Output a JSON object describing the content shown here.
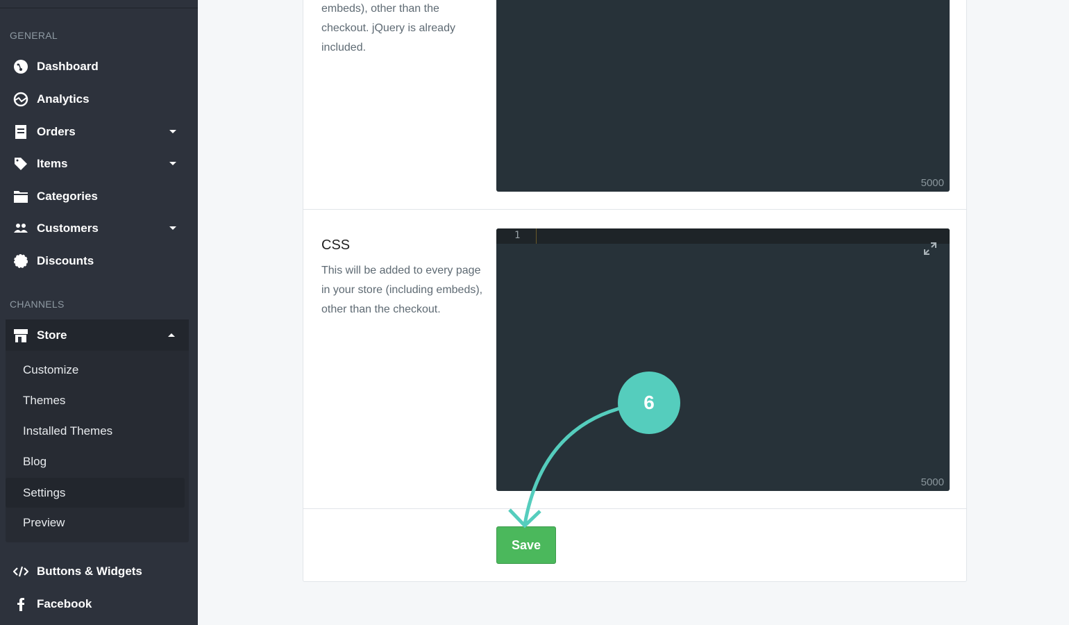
{
  "sidebar": {
    "general": "GENERAL",
    "items": [
      {
        "label": "Dashboard",
        "icon": "dashboard-icon"
      },
      {
        "label": "Analytics",
        "icon": "analytics-icon"
      },
      {
        "label": "Orders",
        "icon": "receipt-icon"
      },
      {
        "label": "Items",
        "icon": "tag-icon"
      },
      {
        "label": "Categories",
        "icon": "folder-icon"
      },
      {
        "label": "Customers",
        "icon": "users-icon"
      },
      {
        "label": "Discounts",
        "icon": "badge-icon"
      }
    ],
    "channels": "CHANNELS",
    "store": {
      "label": "Store",
      "icon": "store-icon",
      "sub": [
        "Customize",
        "Themes",
        "Installed Themes",
        "Blog",
        "Settings",
        "Preview"
      ]
    },
    "more": [
      {
        "label": "Buttons & Widgets",
        "icon": "code-icon"
      },
      {
        "label": "Facebook",
        "icon": "facebook-icon"
      }
    ]
  },
  "main": {
    "js_desc": "embeds), other than the checkout. jQuery is already included.",
    "js_count": "5000",
    "css_title": "CSS",
    "css_desc": "This will be added to every page in your store (including embeds), other than the checkout.",
    "css_line": "1",
    "css_count": "5000",
    "save_label": "Save",
    "step": "6"
  },
  "colors": {
    "accent": "#55cdbd",
    "save": "#4bb85c",
    "sidebar": "#2d323c",
    "editor": "#273239"
  }
}
